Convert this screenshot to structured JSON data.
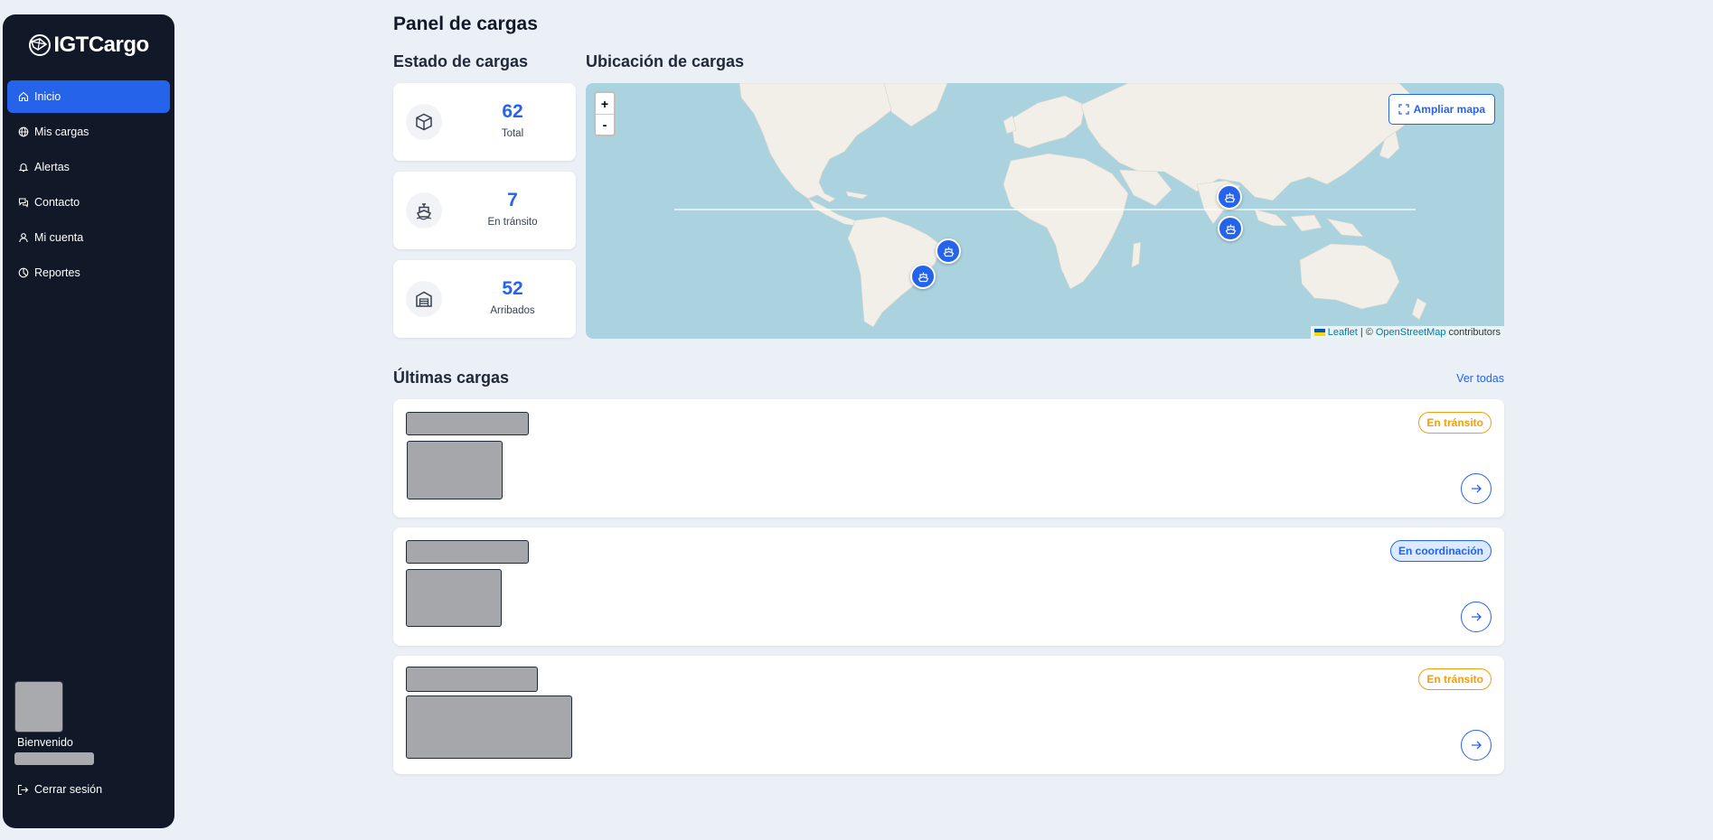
{
  "app": {
    "logo_text": "IGTCargo",
    "logo_icon": "globe-logo-icon"
  },
  "sidebar": {
    "items": [
      {
        "label": "Inicio",
        "icon": "home-icon",
        "active": true
      },
      {
        "label": "Mis cargas",
        "icon": "globe-icon",
        "active": false
      },
      {
        "label": "Alertas",
        "icon": "bell-icon",
        "active": false
      },
      {
        "label": "Contacto",
        "icon": "chat-icon",
        "active": false
      },
      {
        "label": "Mi cuenta",
        "icon": "user-icon",
        "active": false
      },
      {
        "label": "Reportes",
        "icon": "pie-chart-icon",
        "active": false
      }
    ],
    "welcome": "Bienvenido",
    "logout_label": "Cerrar sesión"
  },
  "page": {
    "title": "Panel de cargas"
  },
  "status": {
    "title": "Estado de cargas",
    "cards": [
      {
        "value": "62",
        "label": "Total",
        "icon": "box-icon"
      },
      {
        "value": "7",
        "label": "En tránsito",
        "icon": "ship-icon"
      },
      {
        "value": "52",
        "label": "Arribados",
        "icon": "warehouse-icon"
      }
    ]
  },
  "map": {
    "title": "Ubicación de cargas",
    "zoom_in": "+",
    "zoom_out": "-",
    "expand_label": "Ampliar mapa",
    "attribution": {
      "leaflet": "Leaflet",
      "separator": "| ©",
      "osm": "OpenStreetMap",
      "suffix": "contributors"
    },
    "marker_icon": "ship-icon"
  },
  "latest": {
    "title": "Últimas cargas",
    "see_all": "Ver todas",
    "items": [
      {
        "status": "En tránsito",
        "status_color": "#f59e0b"
      },
      {
        "status": "En coordinación",
        "status_color": "#2563eb"
      },
      {
        "status": "En tránsito",
        "status_color": "#f59e0b"
      }
    ]
  },
  "colors": {
    "sidebar_bg": "#111827",
    "accent": "#2563eb",
    "page_bg": "#ebf0f7",
    "transit": "#f59e0b",
    "ocean": "#aad3df",
    "land": "#f2efe9"
  }
}
